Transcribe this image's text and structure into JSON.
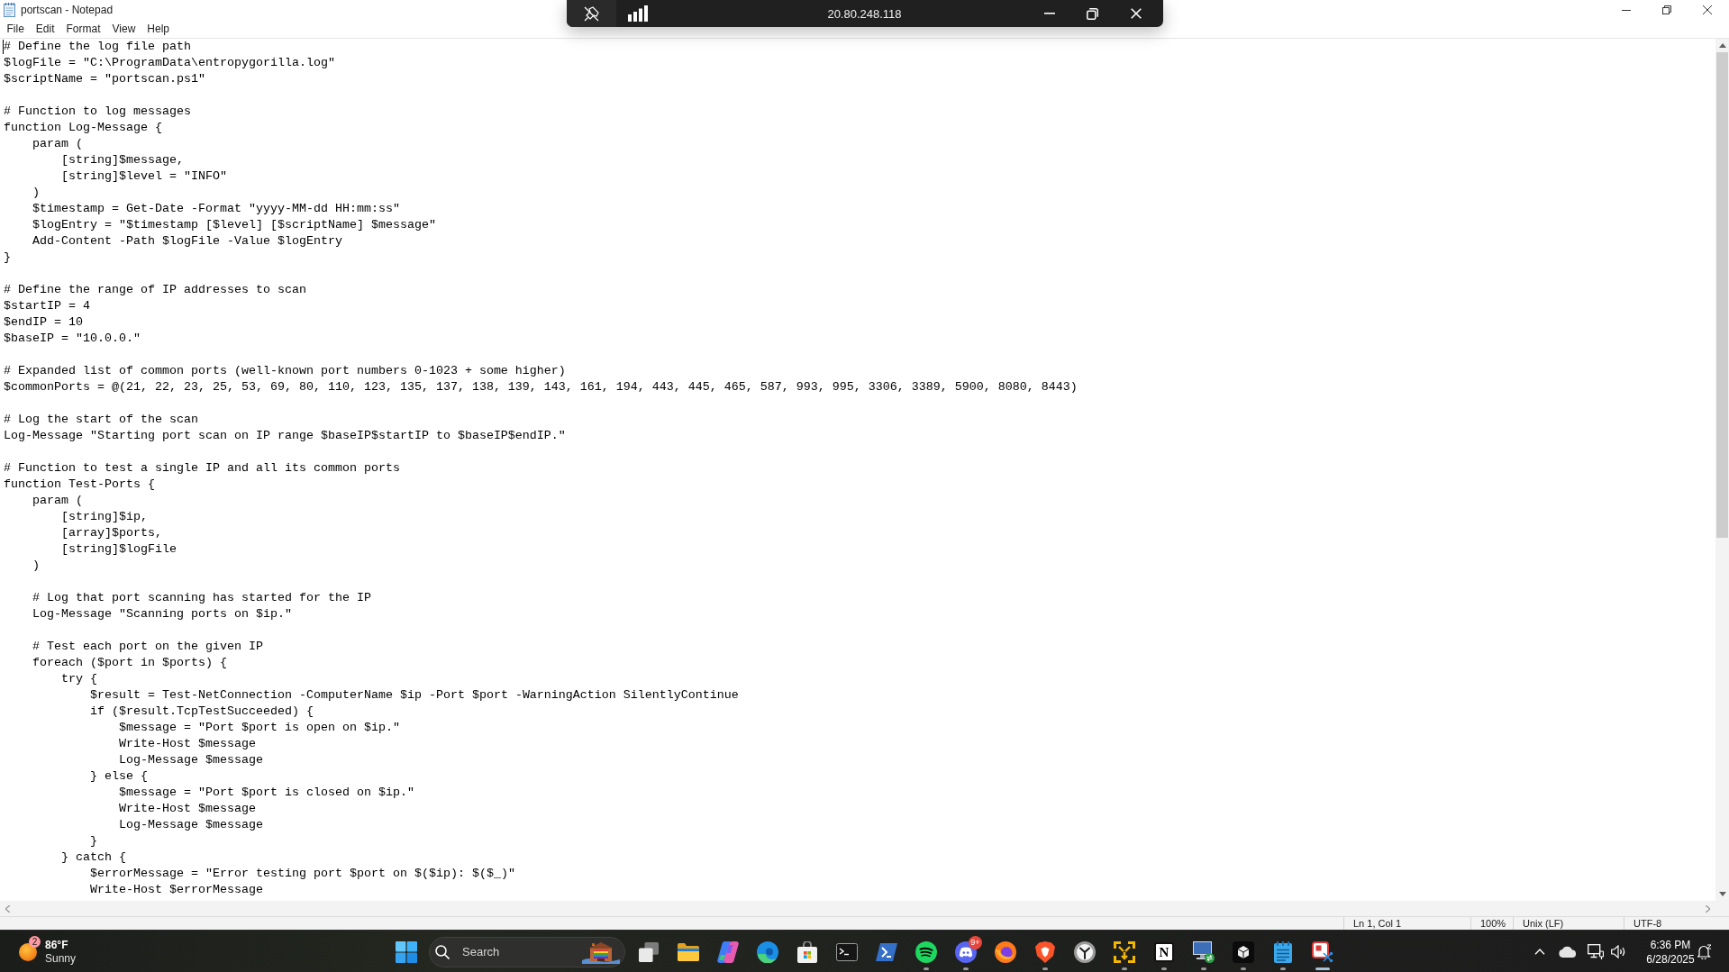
{
  "window": {
    "title": "portscan - Notepad"
  },
  "menu": [
    "File",
    "Edit",
    "Format",
    "View",
    "Help"
  ],
  "editor": {
    "text": "# Define the log file path\n$logFile = \"C:\\ProgramData\\entropygorilla.log\"\n$scriptName = \"portscan.ps1\"\n\n# Function to log messages\nfunction Log-Message {\n    param (\n        [string]$message,\n        [string]$level = \"INFO\"\n    )\n    $timestamp = Get-Date -Format \"yyyy-MM-dd HH:mm:ss\"\n    $logEntry = \"$timestamp [$level] [$scriptName] $message\"\n    Add-Content -Path $logFile -Value $logEntry\n}\n\n# Define the range of IP addresses to scan\n$startIP = 4\n$endIP = 10\n$baseIP = \"10.0.0.\"\n\n# Expanded list of common ports (well-known port numbers 0-1023 + some higher)\n$commonPorts = @(21, 22, 23, 25, 53, 69, 80, 110, 123, 135, 137, 138, 139, 143, 161, 194, 443, 445, 465, 587, 993, 995, 3306, 3389, 5900, 8080, 8443)\n\n# Log the start of the scan\nLog-Message \"Starting port scan on IP range $baseIP$startIP to $baseIP$endIP.\"\n\n# Function to test a single IP and all its common ports\nfunction Test-Ports {\n    param (\n        [string]$ip,\n        [array]$ports,\n        [string]$logFile\n    )\n\n    # Log that port scanning has started for the IP\n    Log-Message \"Scanning ports on $ip.\"\n\n    # Test each port on the given IP\n    foreach ($port in $ports) {\n        try {\n            $result = Test-NetConnection -ComputerName $ip -Port $port -WarningAction SilentlyContinue\n            if ($result.TcpTestSucceeded) {\n                $message = \"Port $port is open on $ip.\"\n                Write-Host $message\n                Log-Message $message\n            } else {\n                $message = \"Port $port is closed on $ip.\"\n                Write-Host $message\n                Log-Message $message\n            }\n        } catch {\n            $errorMessage = \"Error testing port $port on $($ip): $($_)\"\n            Write-Host $errorMessage"
  },
  "status_bar": [
    "Ln 1, Col 1",
    "100%",
    "Unix (LF)",
    "UTF-8"
  ],
  "remote_bar": {
    "address": "20.80.248.118"
  },
  "taskbar": {
    "weather": {
      "badge": "2",
      "temperature": "86°F",
      "condition": "Sunny"
    },
    "search": {
      "placeholder": "Search"
    },
    "apps": [
      {
        "kind": "task-view",
        "running": false,
        "focused": false
      },
      {
        "kind": "folder",
        "running": false,
        "focused": false
      },
      {
        "kind": "swirl",
        "running": false,
        "focused": false
      },
      {
        "kind": "wave",
        "running": false,
        "focused": false
      },
      {
        "kind": "bag",
        "running": false,
        "focused": false
      },
      {
        "kind": "terminal",
        "running": false,
        "focused": false
      },
      {
        "kind": "shell",
        "running": false,
        "focused": false
      },
      {
        "kind": "music",
        "running": true,
        "focused": false
      },
      {
        "kind": "chat",
        "running": true,
        "focused": false,
        "badge": "9+"
      },
      {
        "kind": "fox",
        "running": false,
        "focused": false
      },
      {
        "kind": "shield",
        "running": true,
        "focused": false
      },
      {
        "kind": "clock",
        "running": false,
        "focused": false
      },
      {
        "kind": "arrows",
        "running": true,
        "focused": false
      },
      {
        "kind": "letter-tile",
        "label": "N",
        "running": true,
        "focused": false
      },
      {
        "kind": "monitor",
        "running": true,
        "focused": false
      },
      {
        "kind": "cube",
        "running": true,
        "focused": false
      },
      {
        "kind": "notepad",
        "running": true,
        "focused": false
      },
      {
        "kind": "snip",
        "running": true,
        "focused": true
      }
    ],
    "tray": {
      "time": "6:36 PM",
      "date": "6/28/2025"
    }
  }
}
